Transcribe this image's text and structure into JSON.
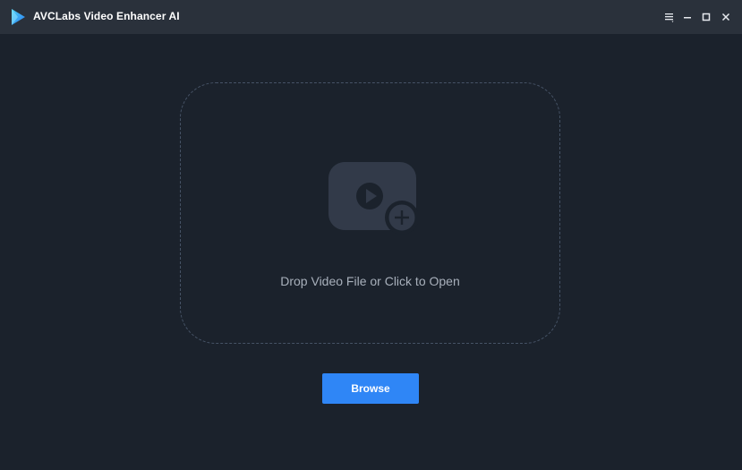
{
  "window": {
    "title": "AVCLabs Video Enhancer AI",
    "controls": {
      "menu": "menu-icon",
      "minimize": "minimize-icon",
      "maximize": "maximize-icon",
      "close": "close-icon"
    }
  },
  "dropzone": {
    "text": "Drop Video File or Click to Open",
    "icon": "video-add-icon"
  },
  "browse": {
    "label": "Browse"
  },
  "colors": {
    "background": "#1b222c",
    "titlebar": "#2a313b",
    "accent": "#2f86f6",
    "dashed_border": "#465366",
    "icon_fill": "#323a49"
  }
}
